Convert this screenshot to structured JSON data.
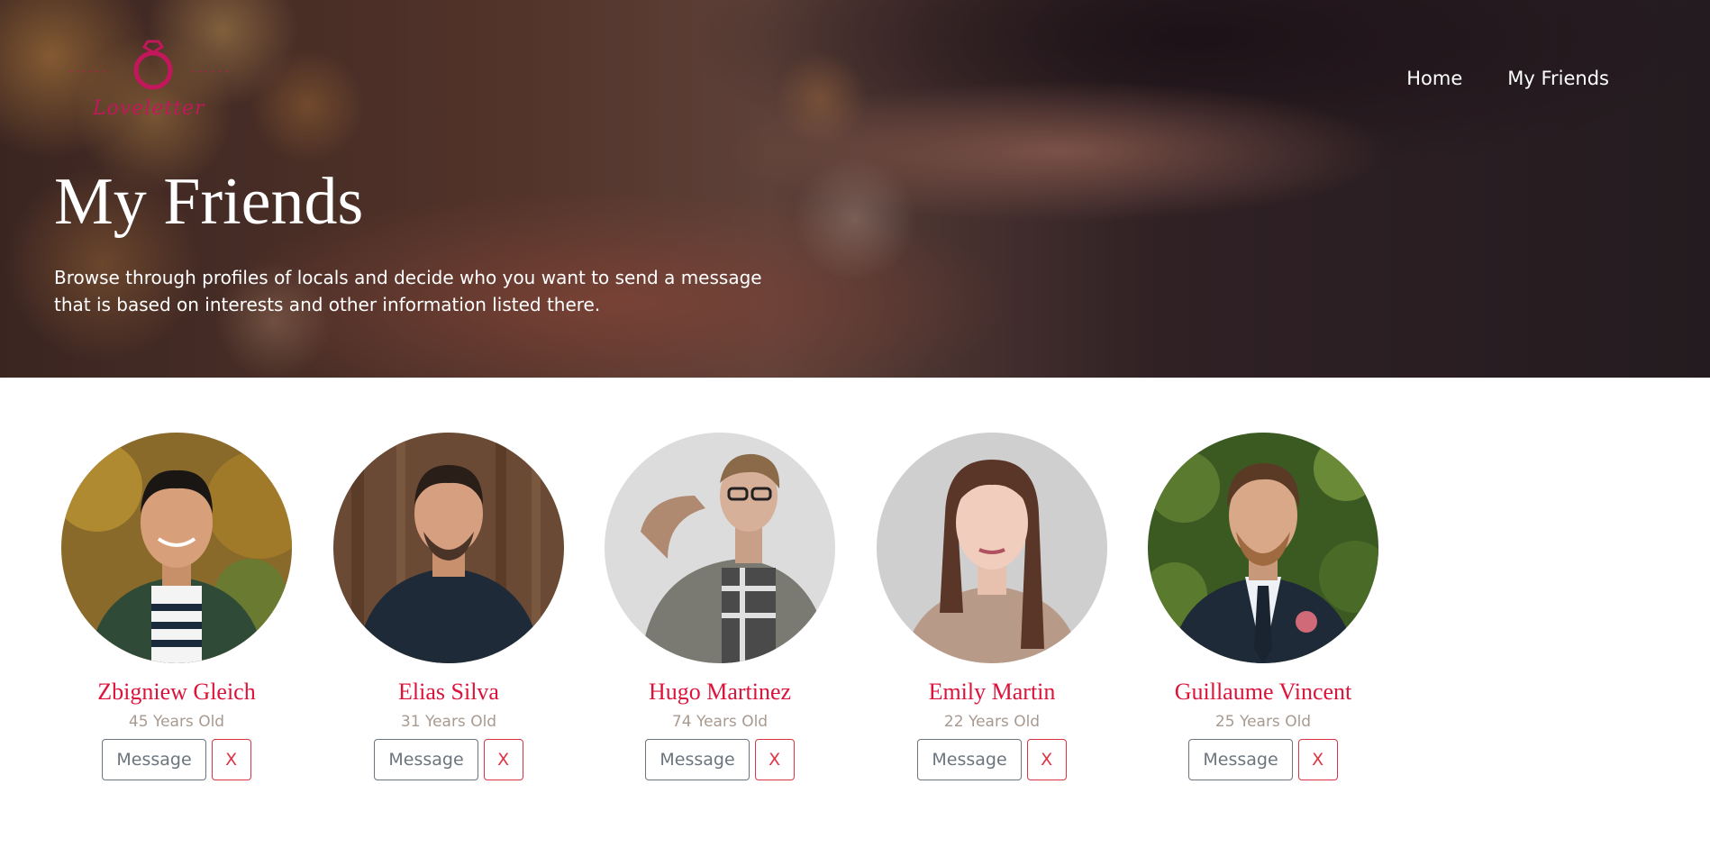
{
  "brand": {
    "name": "Loveletter",
    "dots_left": "......",
    "dots_right": "......",
    "color": "#c2185b"
  },
  "nav": {
    "items": [
      {
        "label": "Home"
      },
      {
        "label": "My Friends"
      }
    ]
  },
  "hero": {
    "title": "My Friends",
    "description": "Browse through profiles of locals and decide who you want to send a message that is based on interests and other information listed there."
  },
  "friends": [
    {
      "name": "Zbigniew Gleich",
      "age": "45 Years Old",
      "message_label": "Message",
      "remove_label": "X"
    },
    {
      "name": "Elias Silva",
      "age": "31 Years Old",
      "message_label": "Message",
      "remove_label": "X"
    },
    {
      "name": "Hugo Martinez",
      "age": "74 Years Old",
      "message_label": "Message",
      "remove_label": "X"
    },
    {
      "name": "Emily Martin",
      "age": "22 Years Old",
      "message_label": "Message",
      "remove_label": "X"
    },
    {
      "name": "Guillaume Vincent",
      "age": "25 Years Old",
      "message_label": "Message",
      "remove_label": "X"
    }
  ],
  "colors": {
    "accent": "#dc143c",
    "secondary": "#6c757d",
    "danger": "#dc3545",
    "muted": "#a89a90"
  }
}
